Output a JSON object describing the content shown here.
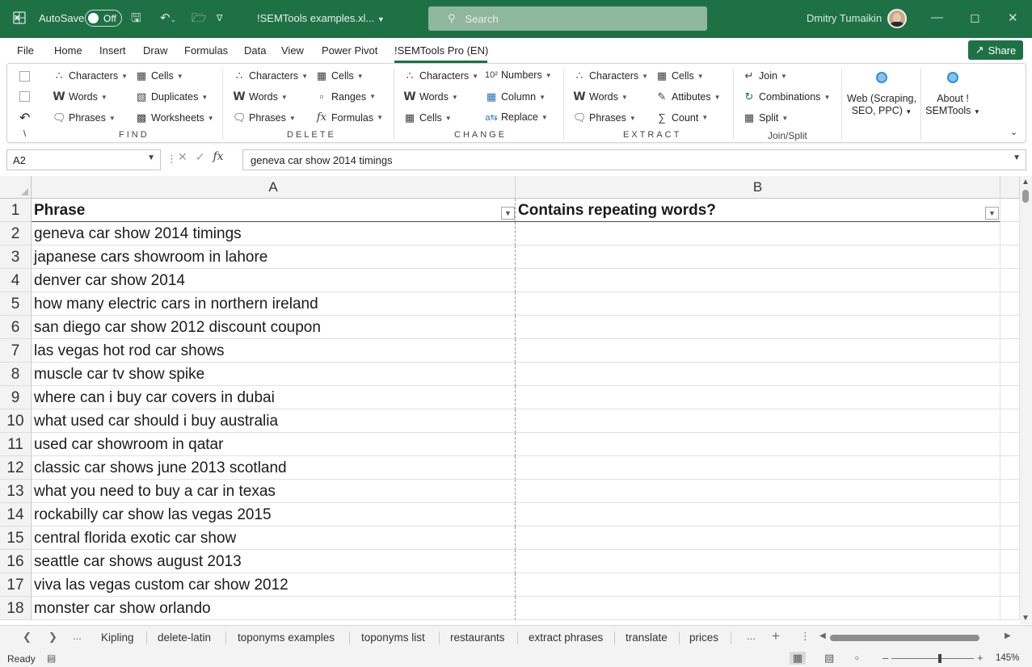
{
  "titlebar": {
    "autosave_label": "AutoSave",
    "autosave_state": "Off",
    "filename": "!SEMTools examples.xl...",
    "search_placeholder": "Search",
    "user_name": "Dmitry Tumaikin"
  },
  "menu": {
    "tabs": [
      "File",
      "Home",
      "Insert",
      "Draw",
      "Formulas",
      "Data",
      "View",
      "Power Pivot",
      "!SEMTools Pro (EN)"
    ],
    "active_tab": "!SEMTools Pro (EN)",
    "share_label": "Share"
  },
  "ribbon": {
    "find": {
      "label": "FIND",
      "col1": [
        "Characters",
        "Words",
        "Phrases"
      ],
      "col2": [
        "Cells",
        "Duplicates",
        "Worksheets"
      ]
    },
    "delete": {
      "label": "DELETE",
      "col1": [
        "Characters",
        "Words",
        "Phrases"
      ],
      "col2": [
        "Cells",
        "Ranges",
        "Formulas"
      ]
    },
    "change": {
      "label": "CHANGE",
      "col1": [
        "Characters",
        "Words",
        "Cells"
      ],
      "col2": [
        "Numbers",
        "Column",
        "Replace"
      ]
    },
    "extract": {
      "label": "EXTRACT",
      "col1": [
        "Characters",
        "Words",
        "Phrases"
      ],
      "col2": [
        "Cells",
        "Attibutes",
        "Count"
      ]
    },
    "joinsplit": {
      "label": "Join/Split",
      "items": [
        "Join",
        "Combinations",
        "Split"
      ]
    },
    "web_button": {
      "line1": "Web (Scraping,",
      "line2": "SEO, PPC)"
    },
    "about_button": {
      "line1": "About !",
      "line2": "SEMTools"
    }
  },
  "formula_bar": {
    "name_box": "A2",
    "formula": "geneva car show 2014 timings"
  },
  "grid": {
    "columns": [
      "A",
      "B"
    ],
    "header_row": {
      "num": "1",
      "a": "Phrase",
      "b": "Contains repeating words?"
    },
    "rows": [
      {
        "num": "2",
        "a": "geneva car show 2014 timings",
        "b": ""
      },
      {
        "num": "3",
        "a": "japanese cars showroom in lahore",
        "b": ""
      },
      {
        "num": "4",
        "a": "denver car show 2014",
        "b": ""
      },
      {
        "num": "5",
        "a": "how many electric cars in northern ireland",
        "b": ""
      },
      {
        "num": "6",
        "a": "san diego car show 2012 discount coupon",
        "b": ""
      },
      {
        "num": "7",
        "a": "las vegas hot rod car shows",
        "b": ""
      },
      {
        "num": "8",
        "a": "muscle car tv show spike",
        "b": ""
      },
      {
        "num": "9",
        "a": "where can i buy car covers in dubai",
        "b": ""
      },
      {
        "num": "10",
        "a": "what used car should i buy australia",
        "b": ""
      },
      {
        "num": "11",
        "a": "used car showroom in qatar",
        "b": ""
      },
      {
        "num": "12",
        "a": "classic car shows june 2013 scotland",
        "b": ""
      },
      {
        "num": "13",
        "a": "what you need to buy a car in texas",
        "b": ""
      },
      {
        "num": "14",
        "a": "rockabilly car show las vegas 2015",
        "b": ""
      },
      {
        "num": "15",
        "a": "central florida exotic car show",
        "b": ""
      },
      {
        "num": "16",
        "a": "seattle car shows august 2013",
        "b": ""
      },
      {
        "num": "17",
        "a": "viva las vegas custom car show 2012",
        "b": ""
      },
      {
        "num": "18",
        "a": "monster car show orlando",
        "b": ""
      }
    ]
  },
  "sheets": {
    "tabs": [
      "Kipling",
      "delete-latin",
      "toponyms examples",
      "toponyms list",
      "restaurants",
      "extract phrases",
      "translate",
      "prices"
    ],
    "more": "...",
    "add": "+"
  },
  "status": {
    "ready": "Ready",
    "zoom": "145%"
  },
  "colors": {
    "excel_green": "#1e7145",
    "ribbon_bg": "#ffffff",
    "header_bg": "#f3f3f3"
  }
}
